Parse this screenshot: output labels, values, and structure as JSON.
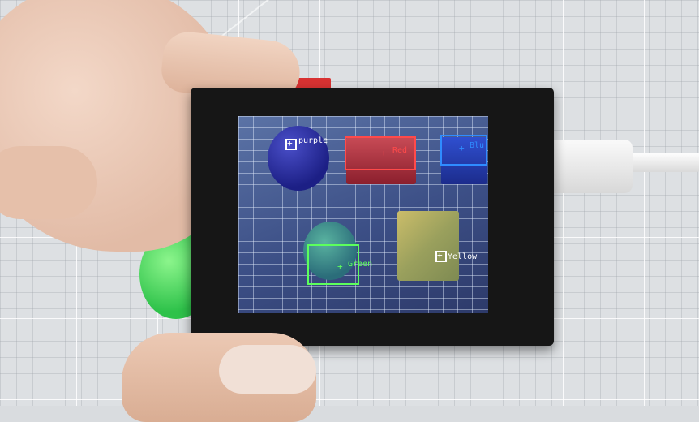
{
  "photo": {
    "subject": "handheld-camera-device",
    "colors": {
      "purple": "#ffffff",
      "red": "#ff4a4a",
      "blue": "#2f8cff",
      "green": "#5cff5c",
      "yellow": "#ffffff"
    }
  },
  "screen": {
    "detections": [
      {
        "label": "purple",
        "color": "#ffffff"
      },
      {
        "label": "Red",
        "color": "#ff4a4a"
      },
      {
        "label": "Blu",
        "color": "#2f8cff"
      },
      {
        "label": "Green",
        "color": "#5cff5c"
      },
      {
        "label": "Yellow",
        "color": "#ffffff"
      }
    ]
  }
}
